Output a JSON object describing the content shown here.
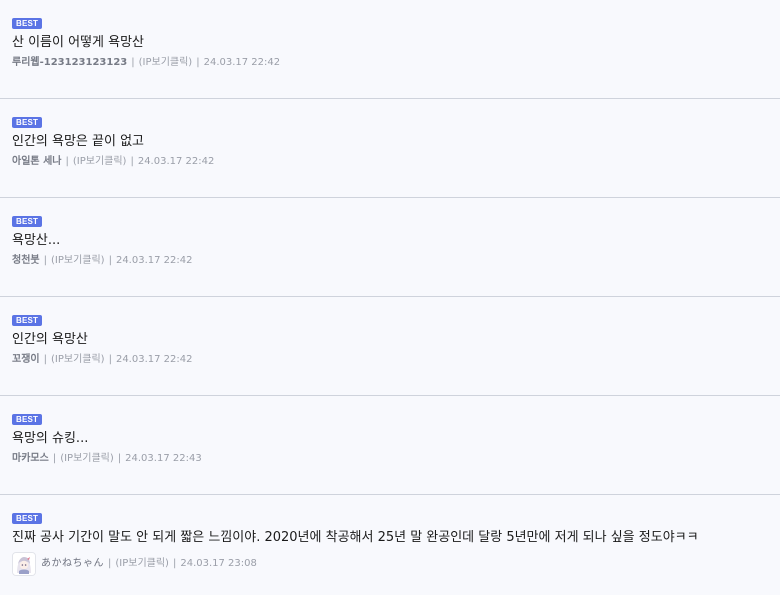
{
  "comments": [
    {
      "badge": "BEST",
      "text": "산 이름이 어떻게 욕망산",
      "nickname": "루리웹-123123123123",
      "ip_label": "(IP보기클릭)",
      "date": "24.03.17 22:42"
    },
    {
      "badge": "BEST",
      "text": "인간의 욕망은 끝이 없고",
      "nickname": "아일톤 세나",
      "ip_label": "(IP보기클릭)",
      "date": "24.03.17 22:42"
    },
    {
      "badge": "BEST",
      "text": "욕망산...",
      "nickname": "청천붓",
      "ip_label": "(IP보기클릭)",
      "date": "24.03.17 22:42"
    },
    {
      "badge": "BEST",
      "text": "인간의 욕망산",
      "nickname": "꼬쟁이",
      "ip_label": "(IP보기클릭)",
      "date": "24.03.17 22:42"
    },
    {
      "badge": "BEST",
      "text": "욕망의 슈킹...",
      "nickname": "마카모스",
      "ip_label": "(IP보기클릭)",
      "date": "24.03.17 22:43"
    },
    {
      "badge": "BEST",
      "text": "진짜 공사 기간이 말도 안 되게 짧은 느낌이야. 2020년에 착공해서 25년 말 완공인데 달랑 5년만에 저게 되나 싶을 정도야ㅋㅋ",
      "nickname": "あかねちゃん",
      "ip_label": "(IP보기클릭)",
      "date": "24.03.17 23:08",
      "avatar_icon": "anime-girl-avatar-icon"
    }
  ],
  "separator": "|",
  "colors": {
    "badge": "#5b74e5",
    "background": "#f8f9fd",
    "divider": "#cfd3dc",
    "meta_text": "#9a9ea8"
  }
}
